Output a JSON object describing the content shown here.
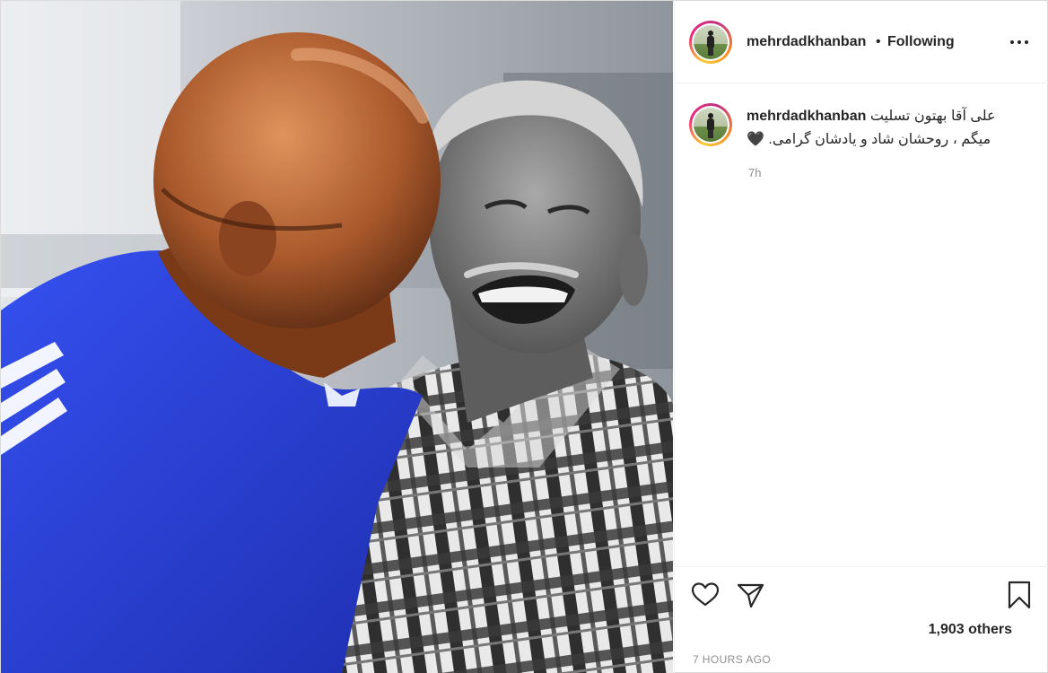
{
  "post": {
    "image_alt": "",
    "author": {
      "username": "mehrdadkhanban",
      "follow_separator": "•",
      "follow_status": "Following",
      "avatar_icon": "profile-avatar"
    },
    "header_menu_icon": "more-options-icon",
    "caption": {
      "username": "mehrdadkhanban",
      "text_line1": "علی آقا بهتون تسلیت",
      "text_line2": "میگم ، روحشان شاد و یادشان گرامی.",
      "emoji": "🖤",
      "relative_time": "7h"
    },
    "actions": {
      "like_icon": "heart-icon",
      "share_icon": "paper-plane-icon",
      "save_icon": "bookmark-icon"
    },
    "likes_text": "1,903 others",
    "timestamp": "7 HOURS AGO"
  },
  "colors": {
    "text": "#262626",
    "secondary_text": "#8e8e8e",
    "border": "#efefef",
    "jersey_blue": "#2a3fd6"
  }
}
